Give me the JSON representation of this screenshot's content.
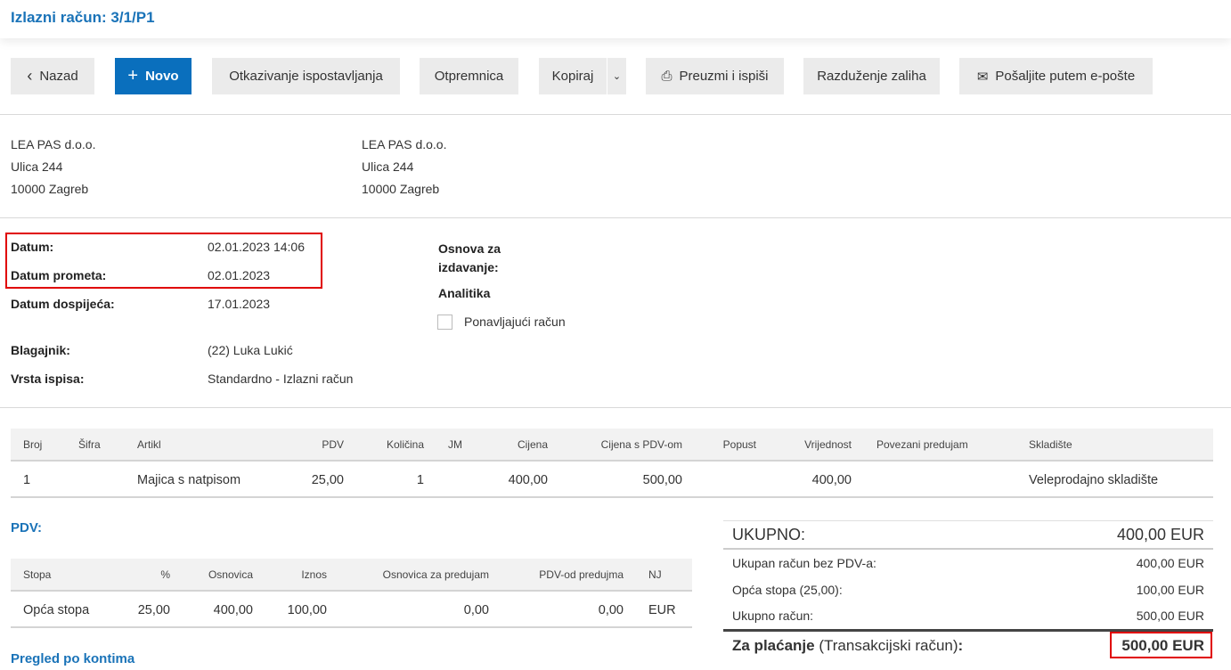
{
  "header": {
    "title": "Izlazni račun: 3/1/P1"
  },
  "toolbar": {
    "back": "Nazad",
    "new": "Novo",
    "cancel_issue": "Otkazivanje ispostavljanja",
    "delivery_note": "Otpremnica",
    "copy": "Kopiraj",
    "download_print": "Preuzmi i ispiši",
    "stock_discharge": "Razduženje zaliha",
    "send_email": "Pošaljite putem e-pošte"
  },
  "issuer": {
    "name": "LEA PAS d.o.o.",
    "street": "Ulica 244",
    "city": "10000 Zagreb"
  },
  "customer": {
    "name": "LEA PAS d.o.o.",
    "street": "Ulica 244",
    "city": "10000 Zagreb"
  },
  "details": {
    "date_label": "Datum:",
    "date": "02.01.2023 14:06",
    "turnover_label": "Datum prometa:",
    "turnover": "02.01.2023",
    "due_label": "Datum dospijeća:",
    "due": "17.01.2023",
    "cashier_label": "Blagajnik:",
    "cashier": "(22) Luka Lukić",
    "print_type_label": "Vrsta ispisa:",
    "print_type": "Standardno - Izlazni račun",
    "basis_label_1": "Osnova za",
    "basis_label_2": "izdavanje:",
    "analytics_label": "Analitika",
    "recurring_label": "Ponavljajući račun",
    "recurring_checked": false
  },
  "items_table": {
    "headers": [
      "Broj",
      "Šifra",
      "Artikl",
      "PDV",
      "Količina",
      "JM",
      "Cijena",
      "Cijena s PDV-om",
      "Popust",
      "Vrijednost",
      "Povezani predujam",
      "Skladište"
    ],
    "rows": [
      [
        "1",
        "",
        "Majica s natpisom",
        "25,00",
        "1",
        "",
        "400,00",
        "500,00",
        "",
        "400,00",
        "",
        "Veleprodajno skladište"
      ]
    ]
  },
  "vat": {
    "title": "PDV:",
    "headers": [
      "Stopa",
      "%",
      "Osnovica",
      "Iznos",
      "Osnovica za predujam",
      "PDV-od predujma",
      "NJ"
    ],
    "rows": [
      [
        "Opća stopa",
        "25,00",
        "400,00",
        "100,00",
        "0,00",
        "0,00",
        "EUR"
      ]
    ]
  },
  "accounts_title": "Pregled po kontima",
  "summary": {
    "total_label": "UKUPNO:",
    "total": "400,00 EUR",
    "no_vat_label": "Ukupan račun bez PDV-a:",
    "no_vat": "400,00 EUR",
    "general_rate_label": "Opća stopa (25,00):",
    "general_rate": "100,00 EUR",
    "invoice_total_label": "Ukupno račun:",
    "invoice_total": "500,00 EUR",
    "pay_label": "Za plaćanje",
    "pay_account": "(Transakcijski račun)",
    "pay_colon": ":",
    "pay": "500,00 EUR"
  },
  "colors": {
    "accent": "#1a73b8",
    "primary_button": "#0a6fbd",
    "highlight": "#e00000"
  }
}
